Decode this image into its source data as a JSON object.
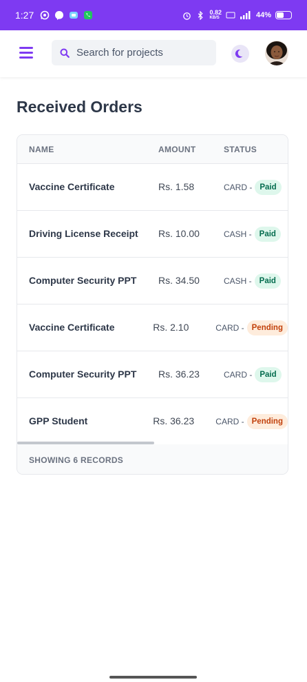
{
  "status_bar": {
    "time": "1:27",
    "network_speed": "0.82",
    "network_unit": "KB/S",
    "battery": "44%"
  },
  "header": {
    "search_placeholder": "Search for projects",
    "icons": [
      "menu-icon",
      "search-icon",
      "moon-icon",
      "avatar"
    ],
    "accent_color": "#7e3af2"
  },
  "page": {
    "title": "Received Orders"
  },
  "table": {
    "columns": [
      "NAME",
      "AMOUNT",
      "STATUS"
    ],
    "rows": [
      {
        "name": "Vaccine Certificate",
        "amount": "Rs. 1.58",
        "method": "CARD -",
        "status": "Paid"
      },
      {
        "name": "Driving License Receipt",
        "amount": "Rs. 10.00",
        "method": "CASH -",
        "status": "Paid"
      },
      {
        "name": "Computer Security PPT",
        "amount": "Rs. 34.50",
        "method": "CASH -",
        "status": "Paid"
      },
      {
        "name": "Vaccine Certificate",
        "amount": "Rs. 2.10",
        "method": "CARD -",
        "status": "Pending"
      },
      {
        "name": "Computer Security PPT",
        "amount": "Rs. 36.23",
        "method": "CARD -",
        "status": "Paid"
      },
      {
        "name": "GPP Student",
        "amount": "Rs. 36.23",
        "method": "CARD -",
        "status": "Pending"
      }
    ],
    "footer": "SHOWING 6 RECORDS"
  },
  "colors": {
    "paid_bg": "#def7ec",
    "paid_text": "#046c4e",
    "pending_bg": "#feecdc",
    "pending_text": "#c2410c"
  }
}
